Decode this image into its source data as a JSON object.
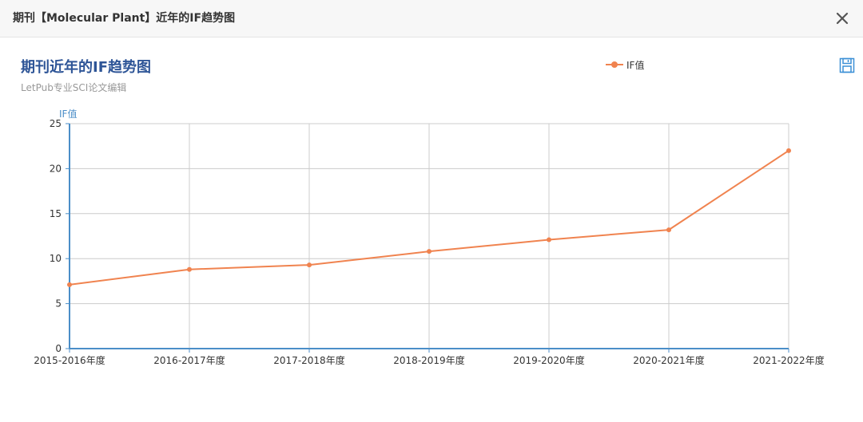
{
  "dialog": {
    "title": "期刊【Molecular Plant】近年的IF趋势图",
    "close_icon": "close-icon"
  },
  "toolbox": {
    "save_icon": "save-as-image-icon"
  },
  "colors": {
    "series": "#f0834f",
    "title": "#2e5597",
    "axis": "#4b8ec8",
    "grid": "#cccccc"
  },
  "chart_data": {
    "type": "line",
    "title": "期刊近年的IF趋势图",
    "subtitle": "LetPub专业SCI论文编辑",
    "ylabel": "IF值",
    "xlabel": "",
    "legend_position": "top-right",
    "grid": true,
    "ylim": [
      0,
      25
    ],
    "yticks": [
      "0",
      "5",
      "10",
      "15",
      "20",
      "25"
    ],
    "categories": [
      "2015-2016年度",
      "2016-2017年度",
      "2017-2018年度",
      "2018-2019年度",
      "2019-2020年度",
      "2020-2021年度",
      "2021-2022年度"
    ],
    "series": [
      {
        "name": "IF值",
        "values": [
          7.1,
          8.8,
          9.3,
          10.8,
          12.1,
          13.2,
          22.0
        ]
      }
    ]
  }
}
